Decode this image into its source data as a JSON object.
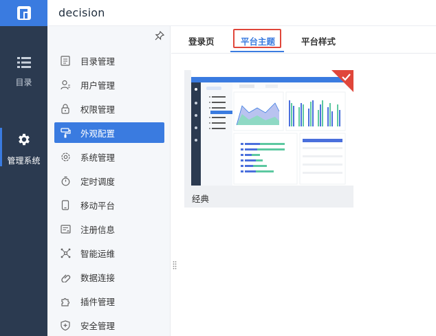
{
  "app": {
    "title": "decision"
  },
  "rail": {
    "items": [
      {
        "label": "目录",
        "icon": "list-icon"
      },
      {
        "label": "管理系统",
        "icon": "gear-icon"
      }
    ]
  },
  "menu": {
    "items": [
      {
        "label": "目录管理",
        "icon": "catalog-icon"
      },
      {
        "label": "用户管理",
        "icon": "user-icon"
      },
      {
        "label": "权限管理",
        "icon": "lock-icon"
      },
      {
        "label": "外观配置",
        "icon": "paint-roller-icon"
      },
      {
        "label": "系统管理",
        "icon": "settings-icon"
      },
      {
        "label": "定时调度",
        "icon": "timer-icon"
      },
      {
        "label": "移动平台",
        "icon": "mobile-icon"
      },
      {
        "label": "注册信息",
        "icon": "registration-icon"
      },
      {
        "label": "智能运维",
        "icon": "network-icon"
      },
      {
        "label": "数据连接",
        "icon": "link-icon"
      },
      {
        "label": "插件管理",
        "icon": "puzzle-icon"
      },
      {
        "label": "安全管理",
        "icon": "shield-icon"
      }
    ],
    "active": "外观配置"
  },
  "tabs": {
    "items": [
      "登录页",
      "平台主题",
      "平台样式"
    ],
    "active": "平台主题"
  },
  "theme": {
    "name": "经典",
    "selected": true
  },
  "colors": {
    "rail": "#2b3a50",
    "accent": "#3a7be0",
    "highlight": "#e0463a",
    "menu_bg": "#f5f7fa"
  }
}
